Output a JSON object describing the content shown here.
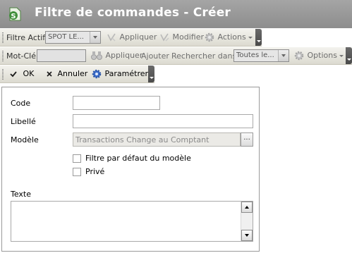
{
  "window": {
    "title": "Filtre de commandes - Créer"
  },
  "filter_toolbar": {
    "active_filter_label": "Filtre Actif",
    "active_filter_value": "SPOT LE...",
    "apply_label": "Appliquer",
    "modify_label": "Modifier",
    "actions_label": "Actions"
  },
  "search_toolbar": {
    "keyword_label": "Mot-Clé",
    "keyword_value": "",
    "apply_label": "Appliquer",
    "add_label": "Ajouter",
    "search_in_label": "Rechercher dans",
    "search_in_value": "Toutes le...",
    "options_label": "Options"
  },
  "action_toolbar": {
    "ok_label": "OK",
    "cancel_label": "Annuler",
    "settings_label": "Paramétrer"
  },
  "form": {
    "code_label": "Code",
    "code_value": "",
    "libelle_label": "Libellé",
    "libelle_value": "",
    "modele_label": "Modèle",
    "modele_value": "Transactions Change au Comptant",
    "browse_label": "...",
    "default_filter_label": "Filtre par défaut du modèle",
    "default_filter_checked": false,
    "private_label": "Privé",
    "private_checked": false,
    "texte_label": "Texte",
    "texte_value": ""
  },
  "colors": {
    "titlebar": "#979797",
    "title_text": "#ffffff",
    "toolbar_bg": "#e8e6dd",
    "toolbar_end": "#555555",
    "panel_border": "#9a9a9a"
  }
}
